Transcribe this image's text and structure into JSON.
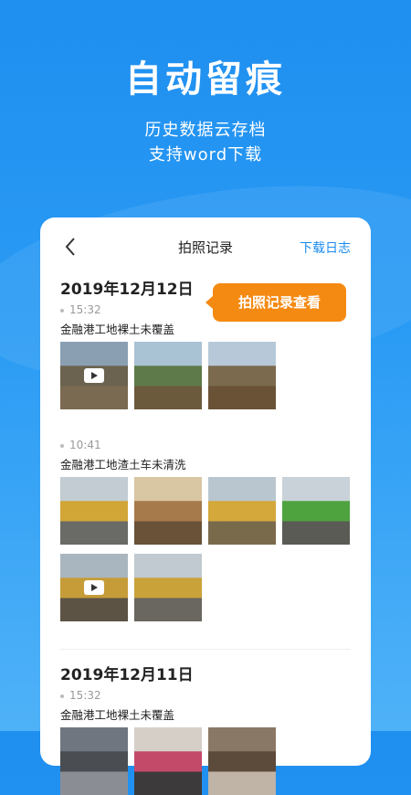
{
  "hero": {
    "title": "自动留痕",
    "line1": "历史数据云存档",
    "line2": "支持word下载"
  },
  "nav": {
    "title": "拍照记录",
    "right_action": "下载日志",
    "back_icon": "chevron-left-icon"
  },
  "tooltip": "拍照记录查看",
  "records": [
    {
      "date": "2019年12月12日",
      "entries": [
        {
          "time": "15:32",
          "location": "金融港工地裸土未覆盖",
          "photos": [
            {
              "type": "video",
              "colors": [
                "#8aa0b2",
                "#6b6350",
                "#7a6a52"
              ]
            },
            {
              "type": "photo",
              "colors": [
                "#a9c2d4",
                "#5f7a4a",
                "#6b5a3c"
              ]
            },
            {
              "type": "photo",
              "colors": [
                "#b7c9d8",
                "#7b6a4e",
                "#6a5236"
              ]
            }
          ]
        },
        {
          "time": "10:41",
          "location": "金融港工地渣土车未清洗",
          "photos": [
            {
              "type": "photo",
              "colors": [
                "#c2ccd2",
                "#d1a637",
                "#6a6a66"
              ]
            },
            {
              "type": "photo",
              "colors": [
                "#d9c6a2",
                "#a77a4c",
                "#6a5238"
              ]
            },
            {
              "type": "photo",
              "colors": [
                "#b9c6cf",
                "#d4a83a",
                "#7a6a4c"
              ]
            },
            {
              "type": "photo",
              "colors": [
                "#c9d2d8",
                "#4ea33f",
                "#5b5b55"
              ]
            },
            {
              "type": "video",
              "colors": [
                "#aab6bf",
                "#c69c38",
                "#5d5345"
              ]
            },
            {
              "type": "photo",
              "colors": [
                "#c0cad0",
                "#caa23a",
                "#6a6660"
              ]
            }
          ]
        }
      ]
    },
    {
      "date": "2019年12月11日",
      "entries": [
        {
          "time": "15:32",
          "location": "金融港工地裸土未覆盖",
          "photos": [
            {
              "type": "photo",
              "colors": [
                "#6f7680",
                "#4a4d52",
                "#8a8e94"
              ]
            },
            {
              "type": "photo",
              "colors": [
                "#d6cfc8",
                "#c44a6a",
                "#3c3a3a"
              ]
            },
            {
              "type": "photo",
              "colors": [
                "#8a7866",
                "#5c4a3a",
                "#c0b4a6"
              ]
            }
          ]
        }
      ]
    }
  ]
}
